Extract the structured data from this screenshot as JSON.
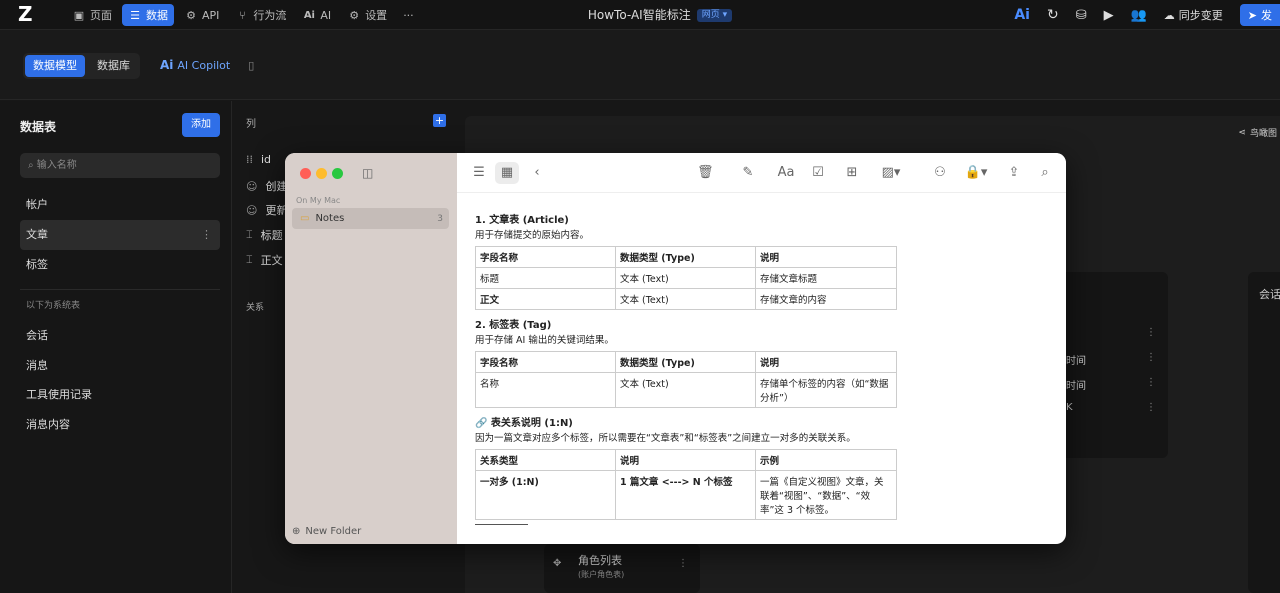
{
  "topbar": {
    "nav": [
      {
        "icon": "page-icon",
        "label": "页面"
      },
      {
        "icon": "database-icon",
        "label": "数据"
      },
      {
        "icon": "api-icon",
        "label": "API"
      },
      {
        "icon": "workflow-icon",
        "label": "行为流"
      },
      {
        "icon": "ai-icon",
        "label": "AI"
      },
      {
        "icon": "gear-icon",
        "label": "设置"
      }
    ],
    "more": "···",
    "app_title": "HowTo-AI智能标注",
    "env_badge": "网页 ▾",
    "sync_label": "同步变更",
    "publish_label": "发"
  },
  "subbar": {
    "seg_model": "数据模型",
    "seg_db": "数据库",
    "copilot": "AI Copilot"
  },
  "sidebar": {
    "heading": "数据表",
    "add_label": "添加",
    "search_placeholder": "输入名称",
    "items": [
      "帐户",
      "文章",
      "标签"
    ],
    "system_label": "以下为系统表",
    "system_items": [
      "会话",
      "消息",
      "工具使用记录",
      "消息内容"
    ]
  },
  "columns": {
    "heading": "列",
    "rows": [
      "id",
      "创建",
      "更新",
      "标题",
      "正文"
    ],
    "relation_heading": "关系"
  },
  "canvas": {
    "bird_view": "鸟瞰图",
    "card_right_title": "会话",
    "card_mid_rows": [
      "时间",
      "时间",
      "K"
    ],
    "bottom_card_title": "角色列表",
    "bottom_card_sub": "(账户角色表)"
  },
  "notes": {
    "sidebar_section": "On My Mac",
    "folder": "Notes",
    "folder_count": "3",
    "new_folder": "New Folder",
    "sec1_title": "1. 文章表 (Article)",
    "sec1_desc": "用于存储提交的原始内容。",
    "sec1_headers": [
      "字段名称",
      "数据类型 (Type)",
      "说明"
    ],
    "sec1_rows": [
      [
        "标题",
        "文本 (Text)",
        "存储文章标题"
      ],
      [
        "正文",
        "文本 (Text)",
        "存储文章的内容"
      ]
    ],
    "sec2_title": "2. 标签表 (Tag)",
    "sec2_desc": "用于存储 AI 输出的关键词结果。",
    "sec2_headers": [
      "字段名称",
      "数据类型 (Type)",
      "说明"
    ],
    "sec2_rows": [
      [
        "名称",
        "文本 (Text)",
        "存储单个标签的内容（如“数据分析”）"
      ]
    ],
    "sec3_title": "🔗 表关系说明 (1:N)",
    "sec3_desc": "因为一篇文章对应多个标签，所以需要在“文章表”和“标签表”之间建立一对多的关联关系。",
    "sec3_headers": [
      "关系类型",
      "说明",
      "示例"
    ],
    "sec3_rows": [
      [
        "一对多 (1:N)",
        "1 篇文章 <---> N 个标签",
        "一篇《自定义视图》文章，关联着“视图”、“数据”、“效率”这 3 个标签。"
      ]
    ]
  }
}
